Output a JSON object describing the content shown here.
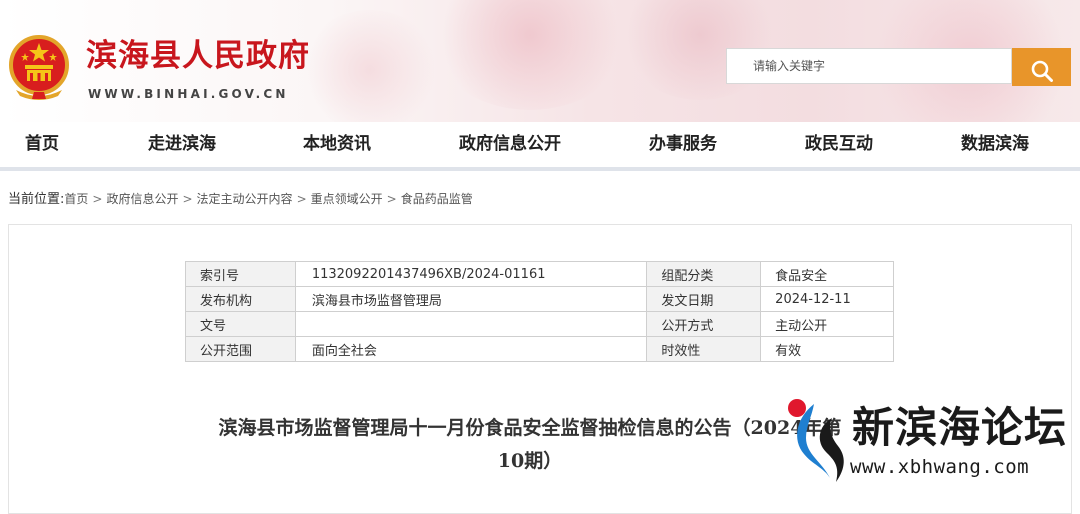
{
  "header": {
    "site_title": "滨海县人民政府",
    "site_domain": "WWW.BINHAI.GOV.CN",
    "search_placeholder": "请输入关键字"
  },
  "nav": {
    "items": [
      "首页",
      "走进滨海",
      "本地资讯",
      "政府信息公开",
      "办事服务",
      "政民互动",
      "数据滨海"
    ]
  },
  "breadcrumb": {
    "lead": "当前位置:",
    "items": [
      "首页",
      "政府信息公开",
      "法定主动公开内容",
      "重点领域公开",
      "食品药品监管"
    ],
    "separator": ">"
  },
  "meta": {
    "rows": [
      [
        "索引号",
        "1132092201437496XB/2024-01161",
        "组配分类",
        "食品安全"
      ],
      [
        "发布机构",
        "滨海县市场监督管理局",
        "发文日期",
        "2024-12-11"
      ],
      [
        "文号",
        "",
        "公开方式",
        "主动公开"
      ],
      [
        "公开范围",
        "面向全社会",
        "时效性",
        "有效"
      ]
    ]
  },
  "article": {
    "title_line1": "滨海县市场监督管理局十一月份食品安全监督抽检信息的公告（2024年第",
    "title_line2": "10期）"
  },
  "watermark": {
    "text": "新滨海论坛",
    "url": "www.xbhwang.com"
  },
  "colors": {
    "brand_red": "#c8161d",
    "search_orange": "#e8952a",
    "watermark_blue": "#1f7fd0",
    "watermark_red": "#e0182d"
  },
  "icons": {
    "search": "magnifier-icon",
    "emblem": "national-emblem-icon"
  }
}
